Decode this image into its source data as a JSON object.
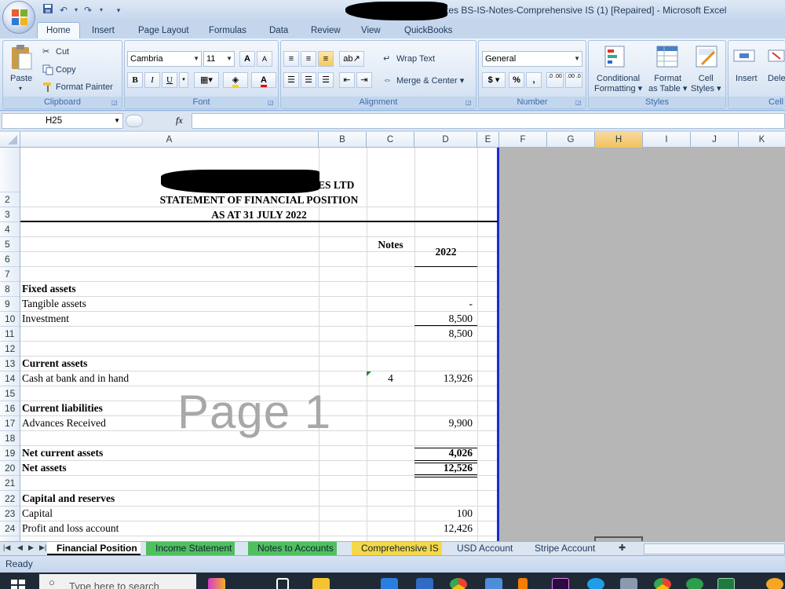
{
  "window": {
    "title": "tes BS-IS-Notes-Comprehensive IS (1) [Repaired] - Microsoft Excel"
  },
  "ribbon": {
    "tabs": [
      "Home",
      "Insert",
      "Page Layout",
      "Formulas",
      "Data",
      "Review",
      "View",
      "QuickBooks"
    ],
    "clipboard": {
      "paste": "Paste",
      "cut": "Cut",
      "copy": "Copy",
      "format_painter": "Format Painter",
      "label": "Clipboard"
    },
    "font": {
      "name": "Cambria",
      "size": "11",
      "bold": "B",
      "italic": "I",
      "underline": "U",
      "grow": "A",
      "shrink": "A",
      "label": "Font"
    },
    "alignment": {
      "wrap_text": "Wrap Text",
      "merge_center": "Merge & Center",
      "label": "Alignment"
    },
    "number": {
      "format": "General",
      "currency": "$",
      "percent": "%",
      "comma": ",",
      "inc_decimal": ".0 .00",
      "dec_decimal": ".00 .0",
      "label": "Number"
    },
    "styles": {
      "conditional": "Conditional",
      "conditional2": "Formatting",
      "format_table": "Format",
      "format_table2": "as Table",
      "cell_styles": "Cell",
      "cell_styles2": "Styles",
      "label": "Styles"
    },
    "cells": {
      "insert": "Insert",
      "delete": "Dele",
      "label": "Cell"
    }
  },
  "formula_bar": {
    "name_box": "H25",
    "fx": "fx",
    "value": ""
  },
  "columns": [
    "A",
    "B",
    "C",
    "D",
    "E",
    "F",
    "G",
    "H",
    "I",
    "J",
    "K"
  ],
  "rows": [
    "2",
    "3",
    "4",
    "5",
    "6",
    "7",
    "8",
    "9",
    "10",
    "11",
    "12",
    "13",
    "14",
    "15",
    "16",
    "17",
    "18",
    "19",
    "20",
    "21",
    "22",
    "23",
    "24"
  ],
  "sheet": {
    "company_suffix": "ES LTD",
    "statement_title": "STATEMENT OF FINANCIAL POSITION",
    "statement_date": "AS AT 31 JULY 2022",
    "notes_header": "Notes",
    "year_header": "2022",
    "watermark": "Page 1",
    "lines": [
      {
        "row": "8",
        "label": "Fixed assets",
        "bold": true,
        "note": "",
        "value": ""
      },
      {
        "row": "9",
        "label": "Tangible assets",
        "bold": false,
        "note": "",
        "value": "-"
      },
      {
        "row": "10",
        "label": "Investment",
        "bold": false,
        "note": "",
        "value": "8,500"
      },
      {
        "row": "11",
        "label": "",
        "bold": false,
        "note": "",
        "value": "8,500"
      },
      {
        "row": "13",
        "label": "Current assets",
        "bold": true,
        "note": "",
        "value": ""
      },
      {
        "row": "14",
        "label": "Cash at bank and in hand",
        "bold": false,
        "note": "4",
        "value": "13,926"
      },
      {
        "row": "16",
        "label": "Current liabilities",
        "bold": true,
        "note": "",
        "value": ""
      },
      {
        "row": "17",
        "label": "Advances Received",
        "bold": false,
        "note": "",
        "value": "9,900"
      },
      {
        "row": "19",
        "label": "Net current assets",
        "bold": true,
        "note": "",
        "value": "4,026"
      },
      {
        "row": "20",
        "label": "Net assets",
        "bold": true,
        "note": "",
        "value": "12,526"
      },
      {
        "row": "22",
        "label": "Capital and reserves",
        "bold": true,
        "note": "",
        "value": ""
      },
      {
        "row": "23",
        "label": "Capital",
        "bold": false,
        "note": "",
        "value": "100"
      },
      {
        "row": "24",
        "label": "Profit and loss account",
        "bold": false,
        "note": "",
        "value": "12,426"
      }
    ]
  },
  "sheet_tabs": [
    "Financial Position",
    "Income Statement",
    "Notes to Accounts",
    "Comprehensive IS",
    "USD Account",
    "Stripe Account"
  ],
  "active_sheet_tab": "Financial Position",
  "status": "Ready",
  "taskbar": {
    "search_placeholder": "Type here to search"
  }
}
